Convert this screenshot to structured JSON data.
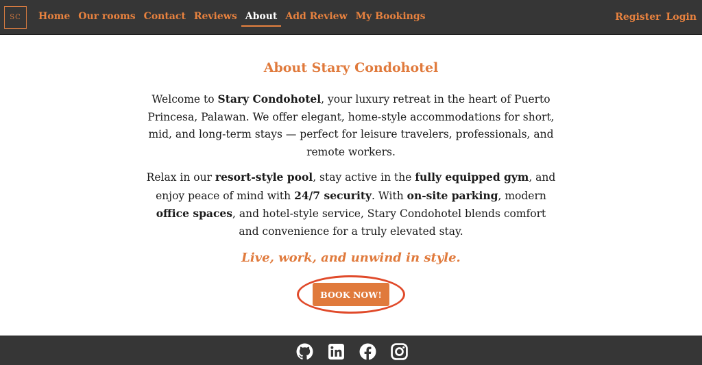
{
  "nav": {
    "logo": "SC",
    "links": [
      "Home",
      "Our rooms",
      "Contact",
      "Reviews",
      "About",
      "Add Review",
      "My Bookings"
    ],
    "active_index": 4,
    "right_links": [
      "Register",
      "Login"
    ]
  },
  "about": {
    "title": "About Stary Condohotel",
    "para1": {
      "t1": "Welcome to ",
      "b1": "Stary Condohotel",
      "t2": ", your luxury retreat in the heart of Puerto Princesa, Palawan. We offer elegant, home-style accommodations for short, mid, and long-term stays — perfect for leisure travelers, professionals, and remote workers."
    },
    "para2": {
      "t1": "Relax in our ",
      "b1": "resort-style pool",
      "t2": ", stay active in the ",
      "b2": "fully equipped gym",
      "t3": ", and enjoy peace of mind with ",
      "b3": "24/7 security",
      "t4": ". With ",
      "b4": "on-site parking",
      "t5": ", modern ",
      "b5": "office spaces",
      "t6": ", and hotel-style service, Stary Condohotel blends comfort and convenience for a truly elevated stay."
    },
    "tagline": "Live, work, and unwind in style.",
    "book_button": "BOOK NOW!"
  },
  "footer": {
    "icons": [
      "github-icon",
      "linkedin-icon",
      "facebook-icon",
      "instagram-icon"
    ]
  },
  "colors": {
    "accent": "#e07a3c",
    "nav_bg": "#363636",
    "highlight_ring": "#e04a2a"
  }
}
